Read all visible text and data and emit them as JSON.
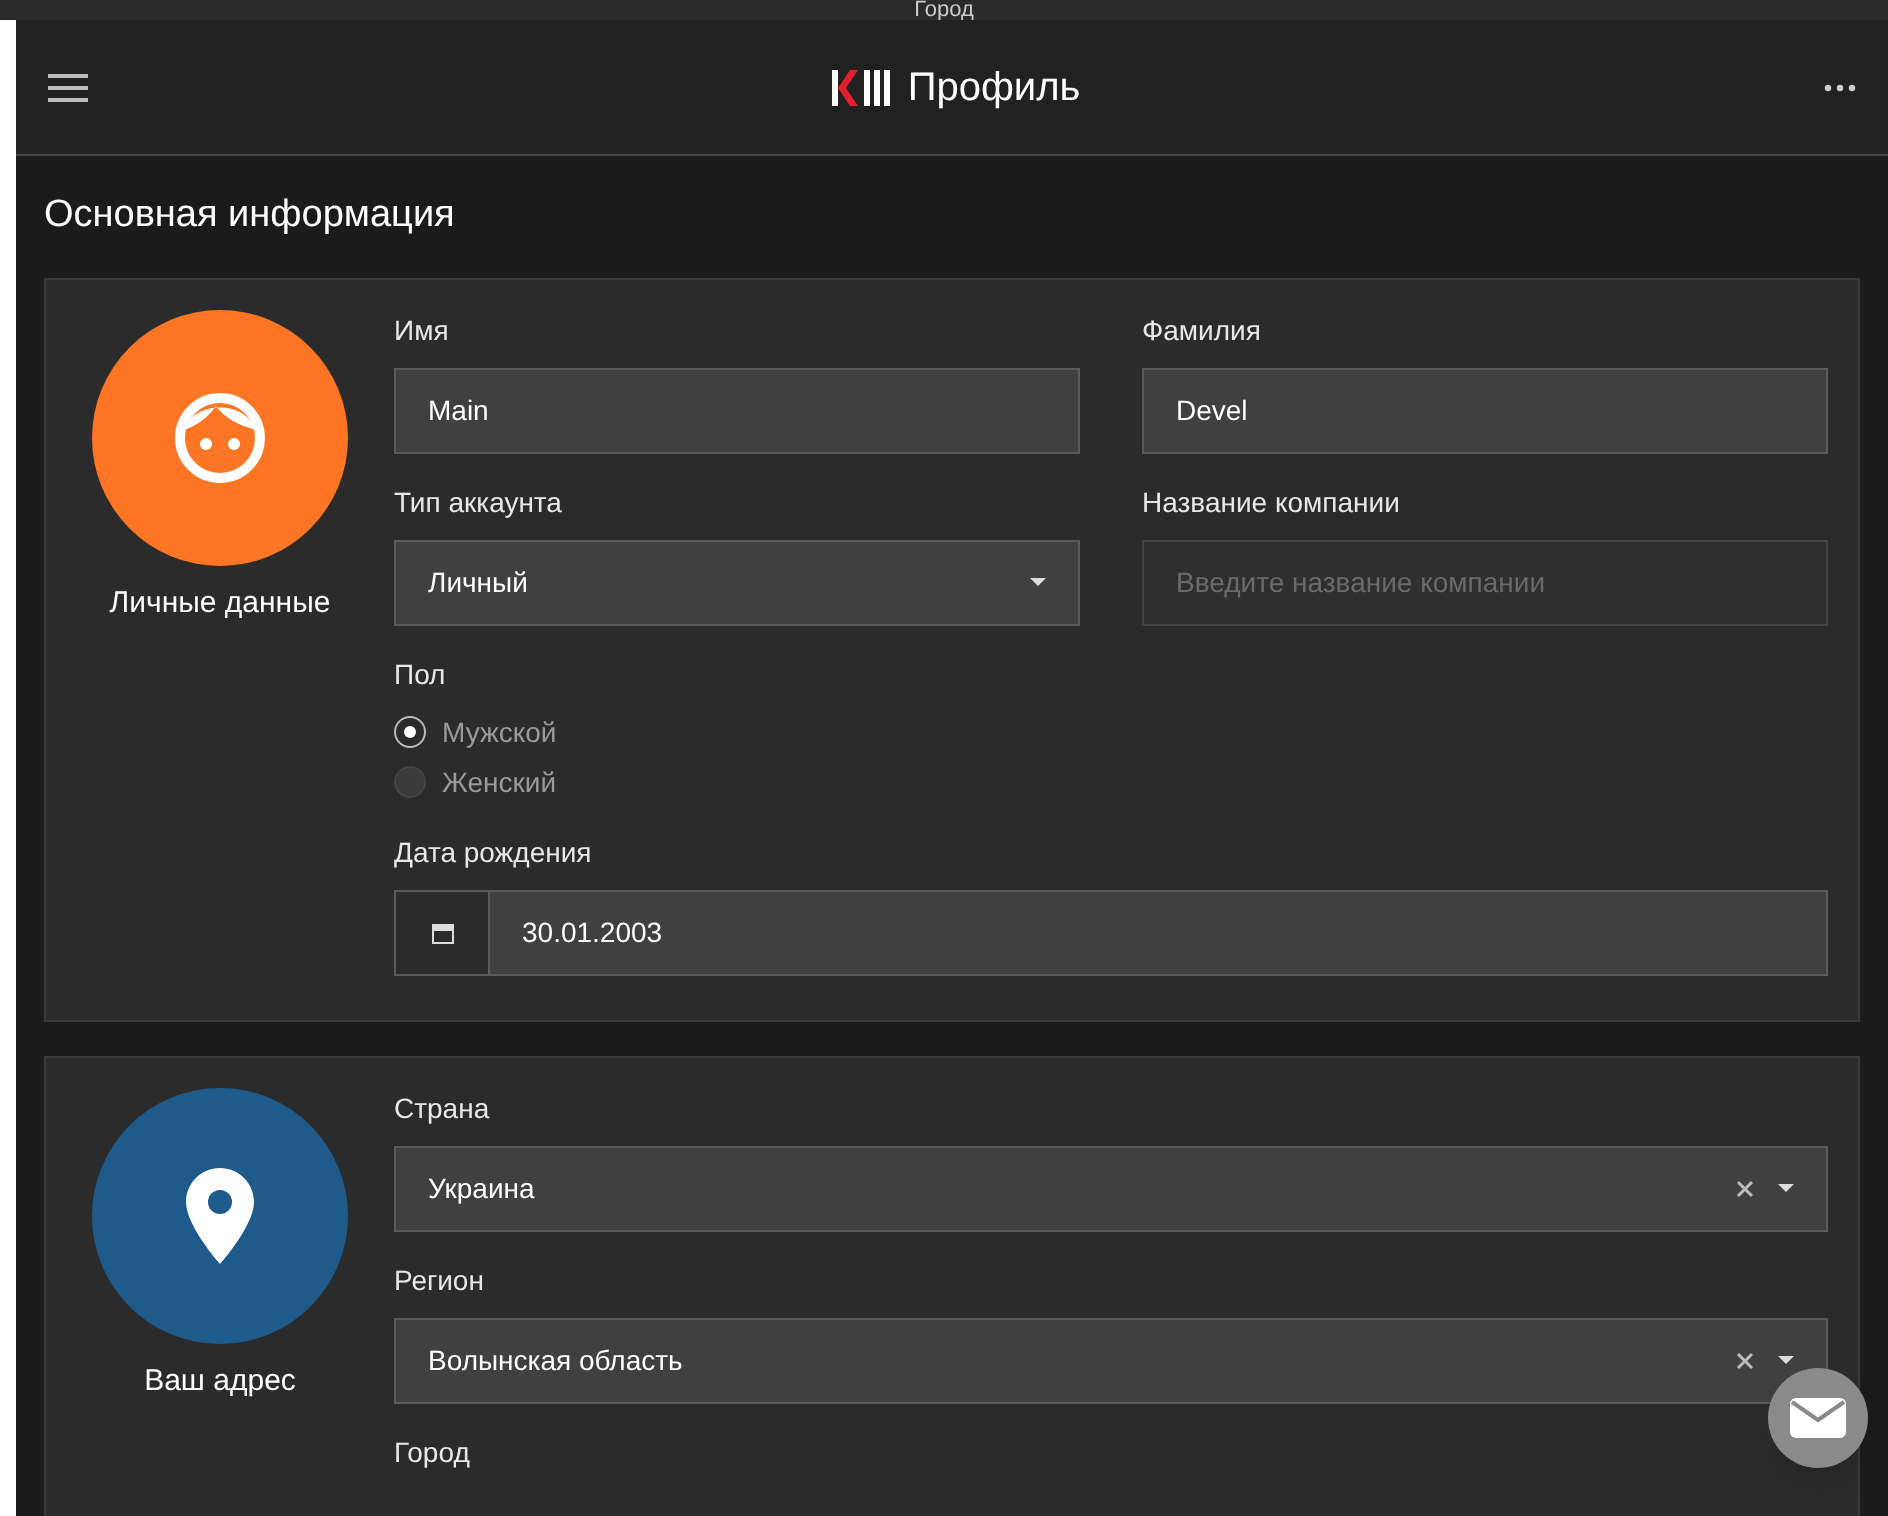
{
  "background_strip": {
    "text": "Город"
  },
  "header": {
    "title": "Профиль"
  },
  "section_title": "Основная информация",
  "cards": [
    {
      "kind": "face",
      "color": "#fe7624",
      "label": "Личные данные",
      "rows": [
        {
          "fields": [
            {
              "kind": "text",
              "label": "Имя",
              "value": "Main"
            },
            {
              "kind": "text",
              "label": "Фамилия",
              "value": "Devel"
            }
          ]
        },
        {
          "fields": [
            {
              "kind": "select",
              "label": "Тип аккаунта",
              "value": "Личный",
              "clearable": false
            },
            {
              "kind": "text",
              "label": "Название компании",
              "placeholder": "Введите название компании"
            }
          ]
        },
        {
          "fields": [
            {
              "kind": "radio",
              "label": "Пол",
              "options": [
                {
                  "label": "Мужской",
                  "selected": true
                },
                {
                  "label": "Женский",
                  "selected": false
                }
              ]
            }
          ]
        },
        {
          "fields": [
            {
              "kind": "date",
              "label": "Дата рождения",
              "value": "30.01.2003"
            }
          ]
        }
      ]
    },
    {
      "kind": "pin",
      "color": "#1f5b8a",
      "label": "Ваш адрес",
      "rows": [
        {
          "fields": [
            {
              "kind": "select",
              "label": "Страна",
              "value": "Украина",
              "clearable": true
            }
          ]
        },
        {
          "fields": [
            {
              "kind": "select",
              "label": "Регион",
              "value": "Волынская область",
              "clearable": true
            }
          ]
        },
        {
          "fields": [
            {
              "kind": "label",
              "label": "Город"
            }
          ]
        }
      ]
    }
  ]
}
